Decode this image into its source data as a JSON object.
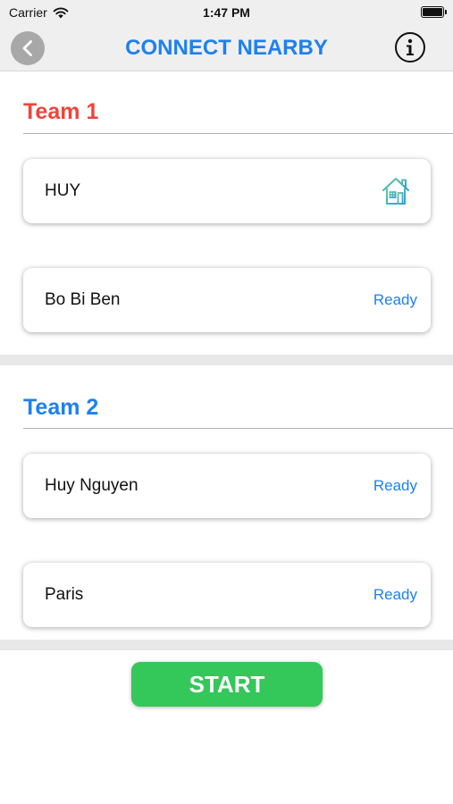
{
  "status_bar": {
    "carrier": "Carrier",
    "time": "1:47 PM"
  },
  "nav": {
    "title": "CONNECT NEARBY",
    "back_icon": "chevron-left-icon",
    "info_icon": "info-icon"
  },
  "teams": [
    {
      "title": "Team 1",
      "color": "#f0443a",
      "players": [
        {
          "name": "HUY",
          "status": "",
          "icon": "home-icon"
        },
        {
          "name": "Bo Bi Ben",
          "status": "Ready"
        }
      ]
    },
    {
      "title": "Team 2",
      "color": "#1e80ef",
      "players": [
        {
          "name": "Huy Nguyen",
          "status": "Ready"
        },
        {
          "name": "Paris",
          "status": "Ready"
        }
      ]
    }
  ],
  "start_label": "START",
  "colors": {
    "accent": "#1e80ef",
    "start": "#34c759",
    "team1": "#f0443a",
    "team2": "#1e80ef",
    "home_icon": "#4ab8a8"
  }
}
